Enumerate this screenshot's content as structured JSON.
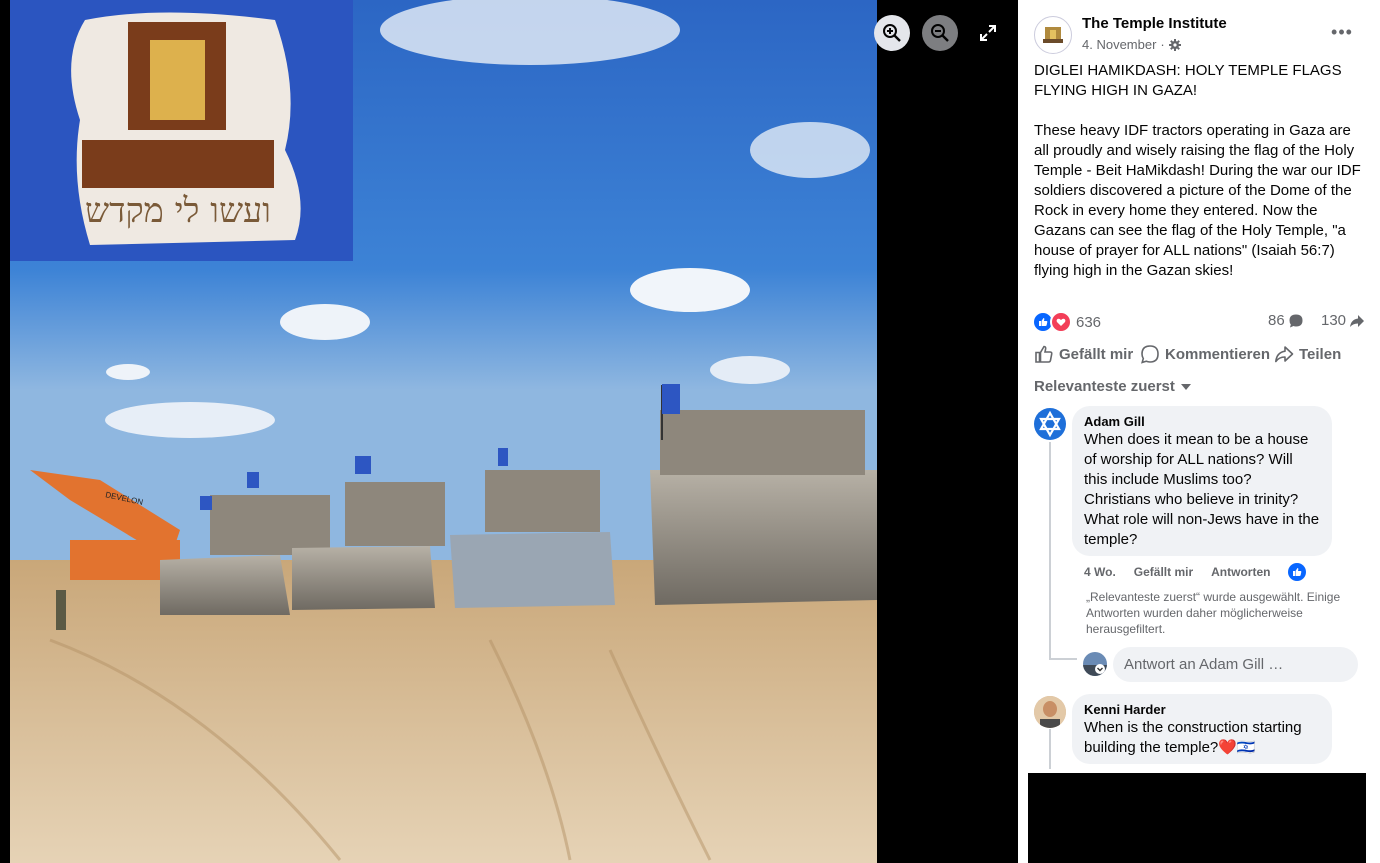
{
  "post": {
    "page_name": "The Temple Institute",
    "date": "4. November",
    "date_separator": "·",
    "title": "DIGLEI HAMIKDASH: HOLY TEMPLE FLAGS FLYING HIGH IN GAZA!",
    "body": "These heavy IDF tractors operating in Gaza are all proudly and wisely raising the flag of the Holy Temple - Beit HaMikdash! During the war our IDF soldiers discovered a picture of the Dome of the Rock in every home they entered. Now the Gazans can see the flag of the Holy Temple, \"a house of prayer for ALL nations\" (Isaiah 56:7) flying high in the Gazan skies!",
    "more_label": "•••"
  },
  "photo": {
    "flag_inscription": "ועשו לי מקדש",
    "excavator_label": "DEVELON"
  },
  "stats": {
    "reactions": "636",
    "comments": "86",
    "shares": "130"
  },
  "actions": {
    "like": "Gefällt mir",
    "comment": "Kommentieren",
    "share": "Teilen"
  },
  "comments_sort": "Relevanteste zuerst",
  "comments": [
    {
      "author": "Adam Gill",
      "text": "When does it mean to be a house of worship for ALL nations? Will this include Muslims too? Christians who believe in trinity? What role will non-Jews have in the temple?",
      "time": "4 Wo.",
      "like": "Gefällt mir",
      "reply": "Antworten"
    },
    {
      "author": "Kenni Harder",
      "text": "When is the construction starting building the temple?❤️🇮🇱"
    }
  ],
  "filter_note": "„Relevanteste zuerst“ wurde ausgewählt. Einige Antworten wurden daher möglicherweise herausgefiltert.",
  "reply_placeholder": "Antwort an Adam Gill …",
  "colors": {
    "fb_blue": "#0866ff",
    "love_red": "#f33e58",
    "text_secondary": "#65676b",
    "bubble_bg": "#f0f2f5"
  }
}
